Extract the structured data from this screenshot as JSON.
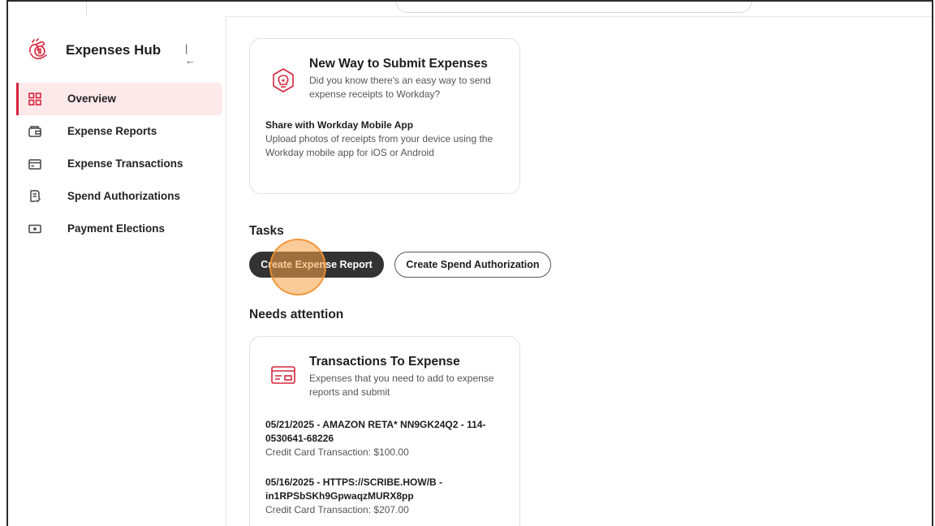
{
  "app": {
    "title": "Expenses Hub",
    "accent_color": "#d7263d"
  },
  "sidebar": {
    "collapse_icon": "collapse-left-icon",
    "items": [
      {
        "label": "Overview",
        "icon": "dashboard-grid-icon",
        "active": true
      },
      {
        "label": "Expense Reports",
        "icon": "wallet-report-icon",
        "active": false
      },
      {
        "label": "Expense Transactions",
        "icon": "card-transaction-icon",
        "active": false
      },
      {
        "label": "Spend Authorizations",
        "icon": "document-check-icon",
        "active": false
      },
      {
        "label": "Payment Elections",
        "icon": "cash-icon",
        "active": false
      }
    ]
  },
  "promo_card": {
    "icon": "lightbulb-icon",
    "title": "New Way to Submit Expenses",
    "description": "Did you know there's an easy way to send expense receipts to Workday?",
    "sub_title": "Share with Workday Mobile App",
    "sub_text": "Upload photos of receipts from your device using the Workday mobile app for iOS or Android"
  },
  "tasks": {
    "heading": "Tasks",
    "primary_button": "Create Expense Report",
    "secondary_button": "Create Spend Authorization"
  },
  "needs_attention": {
    "heading": "Needs attention",
    "card": {
      "icon": "credit-card-icon",
      "title": "Transactions To Expense",
      "description": "Expenses that you need to add to expense reports and submit",
      "transactions": [
        {
          "title": "05/21/2025 - AMAZON RETA* NN9GK24Q2 - 114-0530641-68226",
          "detail": "Credit Card Transaction: $100.00"
        },
        {
          "title": "05/16/2025 - HTTPS://SCRIBE.HOW/B - in1RPSbSKh9GpwaqzMURX8pp",
          "detail": "Credit Card Transaction: $207.00"
        }
      ]
    }
  }
}
